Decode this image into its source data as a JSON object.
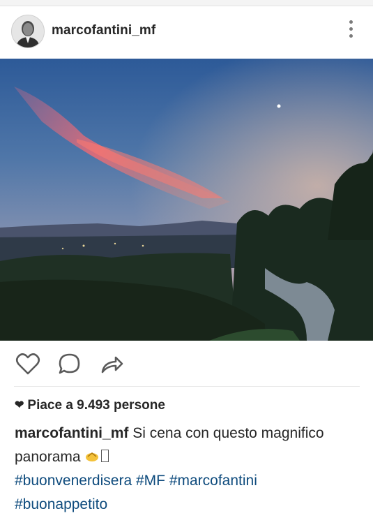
{
  "header": {
    "username": "marcofantini_mf"
  },
  "post": {
    "likes_text": "Piace a 9.493 persone",
    "caption_user": "marcofantini_mf",
    "caption_text": "Si cena con questo magnifico panorama",
    "hashtags": [
      "#buonvenerdisera",
      "#MF",
      "#marcofantini",
      "#buonappetito"
    ]
  },
  "icons": {
    "like": "heart-outline-icon",
    "comment": "speech-bubble-icon",
    "share": "share-arrow-icon",
    "more": "vertical-dots-icon",
    "liked": "heart-filled-icon"
  },
  "colors": {
    "hashtag": "#0e4b7d",
    "text": "#262626",
    "icon": "#5a5a5a"
  }
}
